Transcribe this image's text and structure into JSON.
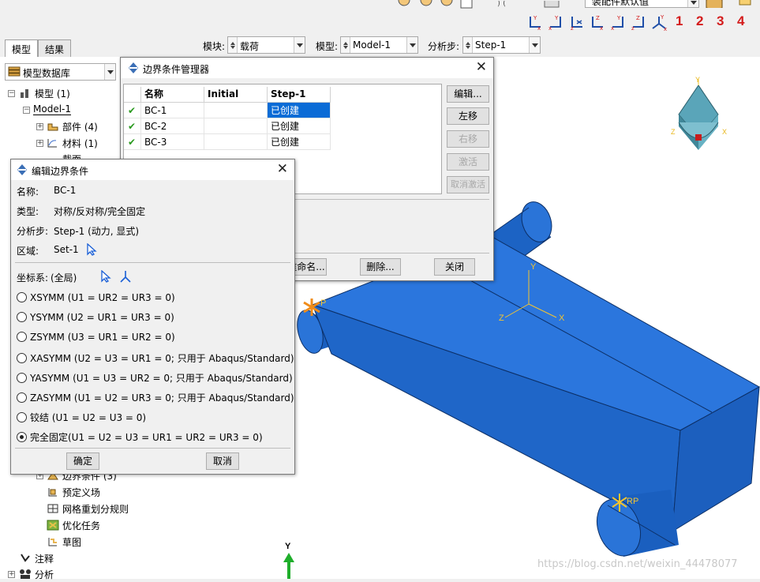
{
  "toolbar": {
    "view_combo_value": "装配件默认值",
    "axis_buttons": [
      "view-x-y-icon",
      "view-y-x-icon",
      "view-z-x-icon",
      "view-x-z-icon",
      "view-z-y-icon",
      "view-y-z-icon",
      "view-iso-icon"
    ],
    "number_buttons": [
      "1",
      "2",
      "3",
      "4"
    ]
  },
  "context_bar": {
    "module_label": "模块:",
    "module_value": "载荷",
    "model_label": "模型:",
    "model_value": "Model-1",
    "step_label": "分析步:",
    "step_value": "Step-1"
  },
  "left_panel": {
    "tabs": [
      "模型",
      "结果"
    ],
    "combo_value": "模型数据库",
    "tree": {
      "root": "模型 (1)",
      "model": "Model-1",
      "parts": "部件 (4)",
      "materials": "材料 (1)",
      "partial_item": "截面",
      "bc_item": "边界条件 (3)",
      "predefined": "预定义场",
      "remesh": "网格重划分规则",
      "optimization": "优化任务",
      "sketch": "草图",
      "annotation": "注释",
      "analysis": "分析"
    }
  },
  "bc_manager": {
    "title": "边界条件管理器",
    "columns": [
      "名称",
      "Initial",
      "Step-1"
    ],
    "rows": [
      {
        "name": "BC-1",
        "initial": "",
        "step": "已创建",
        "selected": true
      },
      {
        "name": "BC-2",
        "initial": "",
        "step": "已创建",
        "selected": false
      },
      {
        "name": "BC-3",
        "initial": "",
        "step": "已创建",
        "selected": false
      }
    ],
    "side_buttons": [
      "编辑...",
      "左移",
      "右移",
      "激活",
      "取消激活"
    ],
    "bottom_buttons": [
      "重命名...",
      "删除...",
      "关闭"
    ]
  },
  "edit_bc": {
    "title": "编辑边界条件",
    "name_label": "名称:",
    "name_value": "BC-1",
    "type_label": "类型:",
    "type_value": "对称/反对称/完全固定",
    "step_label": "分析步:",
    "step_value": "Step-1 (动力, 显式)",
    "region_label": "区域:",
    "region_value": "Set-1",
    "csys_label": "坐标系:",
    "csys_value": "(全局)",
    "options": [
      {
        "label": "XSYMM (U1 = UR2 = UR3 = 0)",
        "checked": false
      },
      {
        "label": "YSYMM (U2 = UR1 = UR3 = 0)",
        "checked": false
      },
      {
        "label": "ZSYMM (U3 = UR1 = UR2 = 0)",
        "checked": false
      },
      {
        "label": "XASYMM (U2 = U3 = UR1 = 0; 只用于 Abaqus/Standard)",
        "checked": false
      },
      {
        "label": "YASYMM (U1 = U3 = UR2 = 0; 只用于 Abaqus/Standard)",
        "checked": false
      },
      {
        "label": "ZASYMM (U1 = U2 = UR3 = 0; 只用于 Abaqus/Standard)",
        "checked": false
      },
      {
        "label": "铰结 (U1 = U2 = U3 = 0)",
        "checked": false
      },
      {
        "label": "完全固定(U1 = U2 = U3 = UR1 = UR2 = UR3 = 0)",
        "checked": true
      }
    ],
    "ok_label": "确定",
    "cancel_label": "取消"
  },
  "viewport": {
    "triad_labels": {
      "x": "X",
      "y": "Y",
      "z": "Z"
    },
    "rp_label_1": "P",
    "rp_label_2": "RP",
    "model_color": "#1e6ed6"
  },
  "watermark": "https://blog.csdn.net/weixin_44478077"
}
